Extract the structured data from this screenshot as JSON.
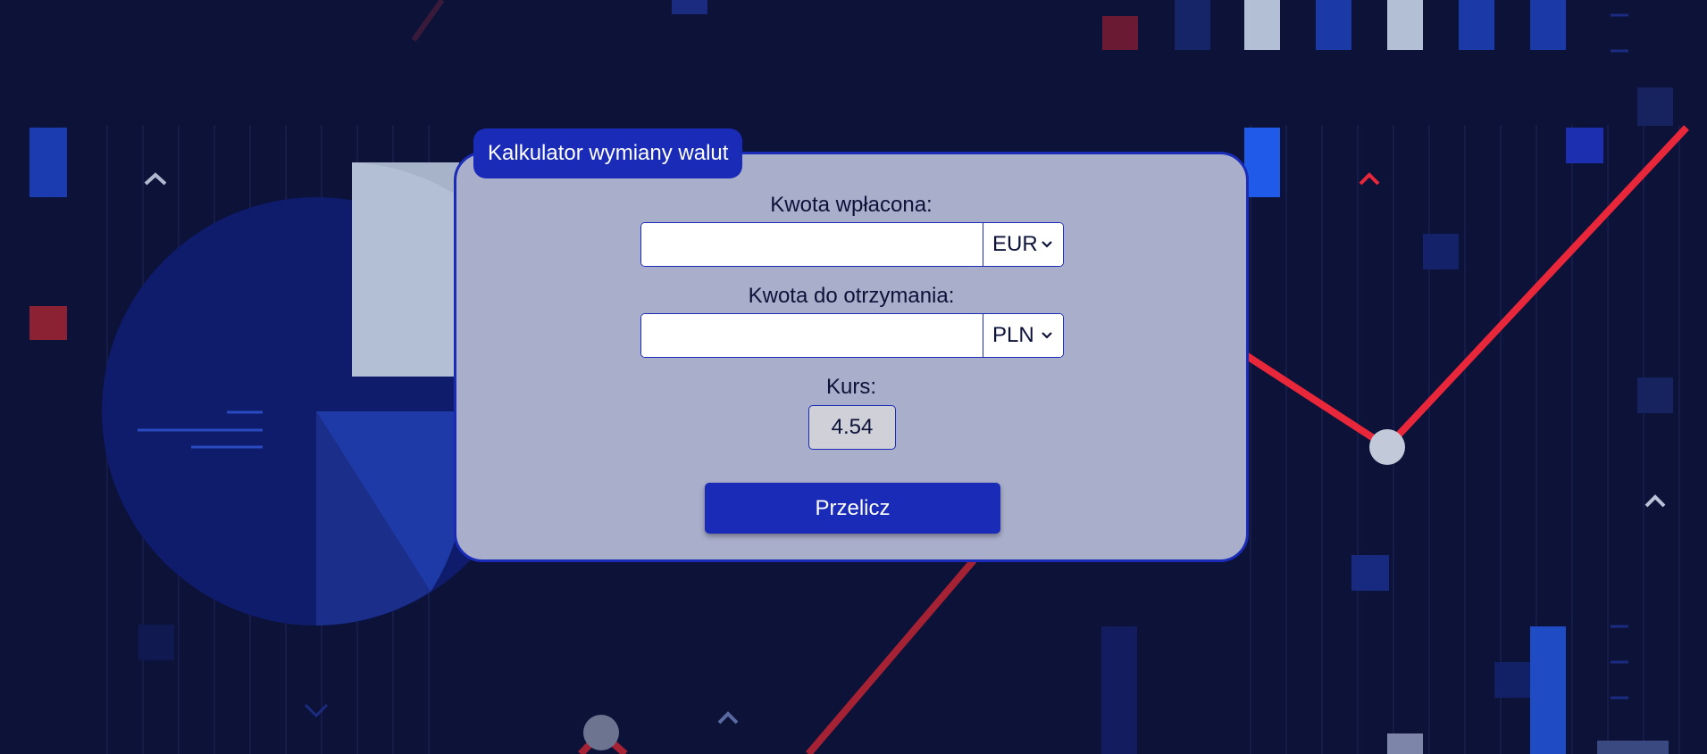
{
  "card": {
    "title": "Kalkulator wymiany walut"
  },
  "paid_amount": {
    "label": "Kwota wpłacona:",
    "value": "",
    "placeholder": "",
    "currency": "EUR"
  },
  "received_amount": {
    "label": "Kwota do otrzymania:",
    "value": "",
    "placeholder": "",
    "currency": "PLN"
  },
  "rate": {
    "label": "Kurs:",
    "value": "4.54"
  },
  "calculate_button": {
    "label": "Przelicz"
  },
  "colors": {
    "background": "#0c1238",
    "card": "#a9aecb",
    "accent": "#1a2bb7",
    "chart_red": "#e8273a",
    "chart_light": "#b9c3d8"
  }
}
